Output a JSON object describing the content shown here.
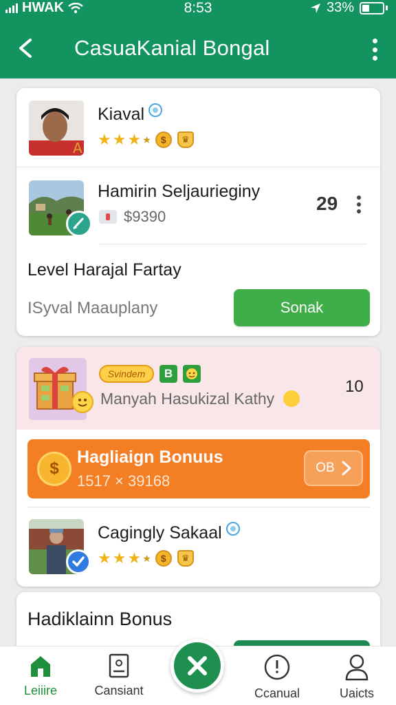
{
  "status_bar": {
    "carrier": "HWAK",
    "time": "8:53",
    "battery": "33%"
  },
  "app_bar": {
    "title": "CasuaKanial Bongal"
  },
  "card1": {
    "user1": {
      "name": "Kiaval",
      "rating_stars": 3,
      "badge": "A"
    },
    "user2": {
      "name": "Hamirin Seljaurieginy",
      "price": "$9390",
      "count": "29"
    },
    "level": {
      "title": "Level Harajal Fartay",
      "subtitle": "ISyval Maauplany",
      "button_label": "Sonak"
    }
  },
  "card2": {
    "promo": {
      "tag_text": "Svindem",
      "tag_b": "B",
      "description": "Manyah Hasukizal Kathy",
      "count": "10"
    },
    "bonus": {
      "title": "Hagliaign Bonuus",
      "subtitle": "1517 × 39168",
      "button_label": "OB"
    },
    "user": {
      "name": "Cagingly Sakaal",
      "rating_stars": 3
    }
  },
  "card3": {
    "title": "Hadiklainn Bonus"
  },
  "bottom_nav": {
    "items": [
      {
        "label": "Leiiire",
        "icon": "home-icon",
        "active": true
      },
      {
        "label": "Cansiant",
        "icon": "tablet-icon",
        "active": false
      },
      {
        "label": "Ccanual",
        "icon": "clock-icon",
        "active": false
      },
      {
        "label": "Uaicts",
        "icon": "person-icon",
        "active": false
      }
    ]
  },
  "colors": {
    "primary": "#13935f",
    "button_green": "#3fae49",
    "bonus_orange": "#f37e23",
    "promo_bg": "#f8e6e8"
  }
}
